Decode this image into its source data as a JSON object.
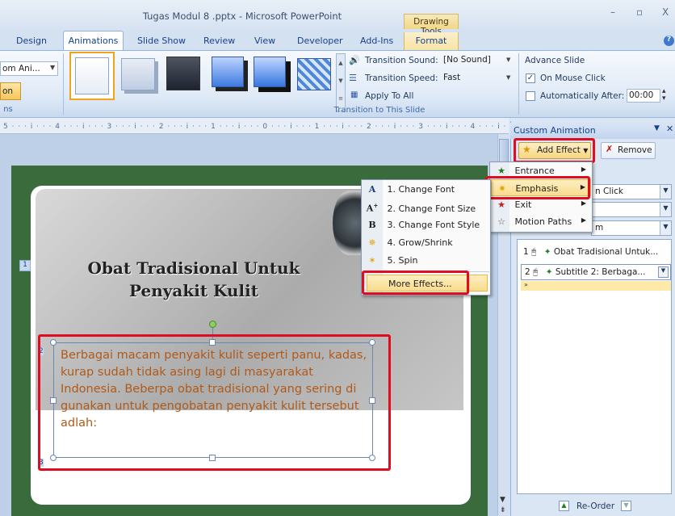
{
  "window": {
    "title": "Tugas Modul 8 .pptx - Microsoft PowerPoint",
    "context_tab": "Drawing Tools",
    "minimize": "–",
    "restore": "▫",
    "close": "X",
    "help": "?"
  },
  "tabs": [
    "Design",
    "Animations",
    "Slide Show",
    "Review",
    "View",
    "Developer",
    "Add-Ins",
    "Format"
  ],
  "ribbon": {
    "custom_anim_partial": "om Ani...",
    "anim_on_partial": "on",
    "group_left_partial": "ns",
    "transition_sound_label": "Transition Sound:",
    "transition_sound_value": "[No Sound]",
    "transition_speed_label": "Transition Speed:",
    "transition_speed_value": "Fast",
    "apply_to_all": "Apply To All",
    "group_transition": "Transition to This Slide",
    "advance_slide": "Advance Slide",
    "on_mouse_click": "On Mouse Click",
    "automatically_after": "Automatically After:",
    "auto_time": "00:00"
  },
  "ruler": "5 · · · i · · · 4 · · · i · · · 3 · · · i · · · 2 · · · i · · · 1 · · · i · · · 0 · · · i · · · 1 · · · i · · · 2 · · · i · · · 3 · · · i · · · 4 · · · i · · ·",
  "slide": {
    "number": "1",
    "title_line1": "Obat Tradisional Untuk",
    "title_line2": "Penyakit Kulit",
    "body": "Berbagai macam penyakit kulit seperti panu, kadas, kurap sudah tidak asing lagi di masyarakat Indonesia. Beberpa obat tradisional yang sering di gunakan untuk pengobatan penyakit kulit tersebut adlah:",
    "marker_2": "2",
    "marker_3": "3"
  },
  "pane": {
    "title": "Custom Animation",
    "add_effect": "Add Effect",
    "remove": "Remove",
    "combo1_value": "n Click",
    "combo3_value": "m",
    "list": [
      {
        "num": "1",
        "label": "Obat Tradisional Untuk..."
      },
      {
        "num": "2",
        "label": "Subtitle 2: Berbaga..."
      }
    ],
    "reorder": "Re-Order"
  },
  "effect_menu": [
    {
      "label": "Entrance",
      "icon": "entrance-star-icon"
    },
    {
      "label": "Emphasis",
      "icon": "emphasis-star-icon"
    },
    {
      "label": "Exit",
      "icon": "exit-star-icon"
    },
    {
      "label": "Motion Paths",
      "icon": "motion-path-star-icon"
    }
  ],
  "emphasis_menu": [
    {
      "label": "1. Change Font",
      "icon": "A"
    },
    {
      "label": "2. Change Font Size",
      "icon": "A"
    },
    {
      "label": "3. Change Font Style",
      "icon": "B"
    },
    {
      "label": "4. Grow/Shrink",
      "icon": "grow-icon"
    },
    {
      "label": "5. Spin",
      "icon": "spin-icon"
    },
    {
      "label": "More Effects...",
      "icon": ""
    }
  ],
  "colors": {
    "highlight_red": "#e00d20",
    "slide_green": "#3a6b3d",
    "body_text": "#b05a1a"
  }
}
